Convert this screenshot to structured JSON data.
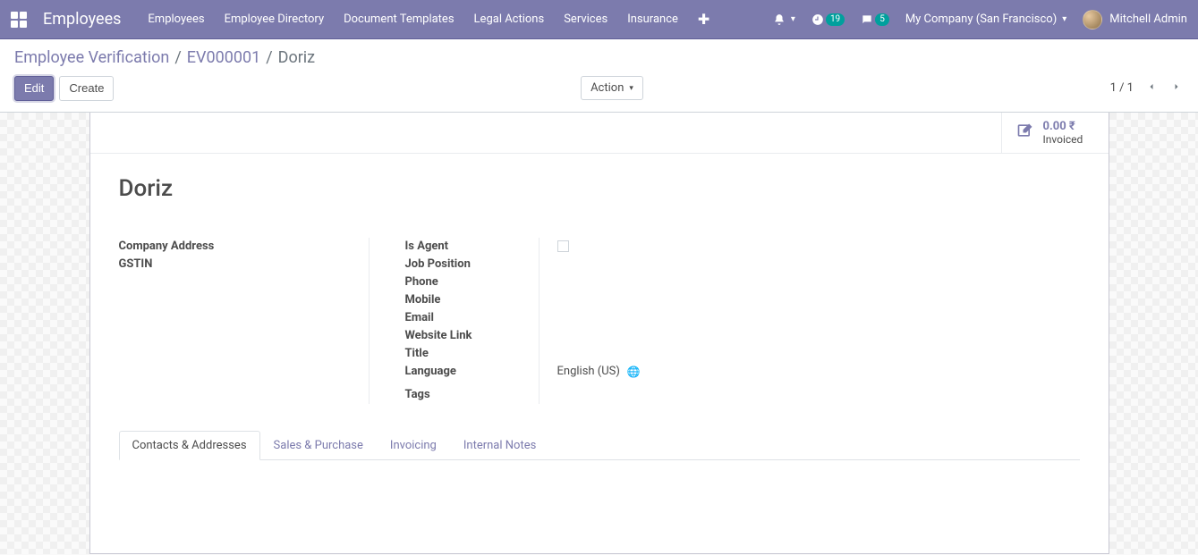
{
  "navbar": {
    "brand": "Employees",
    "links": [
      "Employees",
      "Employee Directory",
      "Document Templates",
      "Legal Actions",
      "Services",
      "Insurance"
    ],
    "clock_badge": "19",
    "chat_badge": "5",
    "company": "My Company (San Francisco)",
    "user": "Mitchell Admin"
  },
  "breadcrumb": {
    "items": [
      "Employee Verification",
      "EV000001"
    ],
    "active": "Doriz"
  },
  "buttons": {
    "edit": "Edit",
    "create": "Create",
    "action": "Action"
  },
  "pager": {
    "text": "1 / 1"
  },
  "stat": {
    "value": "0.00 ₹",
    "label": "Invoiced"
  },
  "record": {
    "title": "Doriz"
  },
  "fields_left": {
    "company_address": "Company Address",
    "gstin": "GSTIN"
  },
  "fields_right": {
    "is_agent": "Is Agent",
    "job_position": "Job Position",
    "phone": "Phone",
    "mobile": "Mobile",
    "email": "Email",
    "website": "Website Link",
    "title": "Title",
    "language": "Language",
    "tags": "Tags"
  },
  "values": {
    "language": "English (US)"
  },
  "tabs": [
    "Contacts & Addresses",
    "Sales & Purchase",
    "Invoicing",
    "Internal Notes"
  ]
}
